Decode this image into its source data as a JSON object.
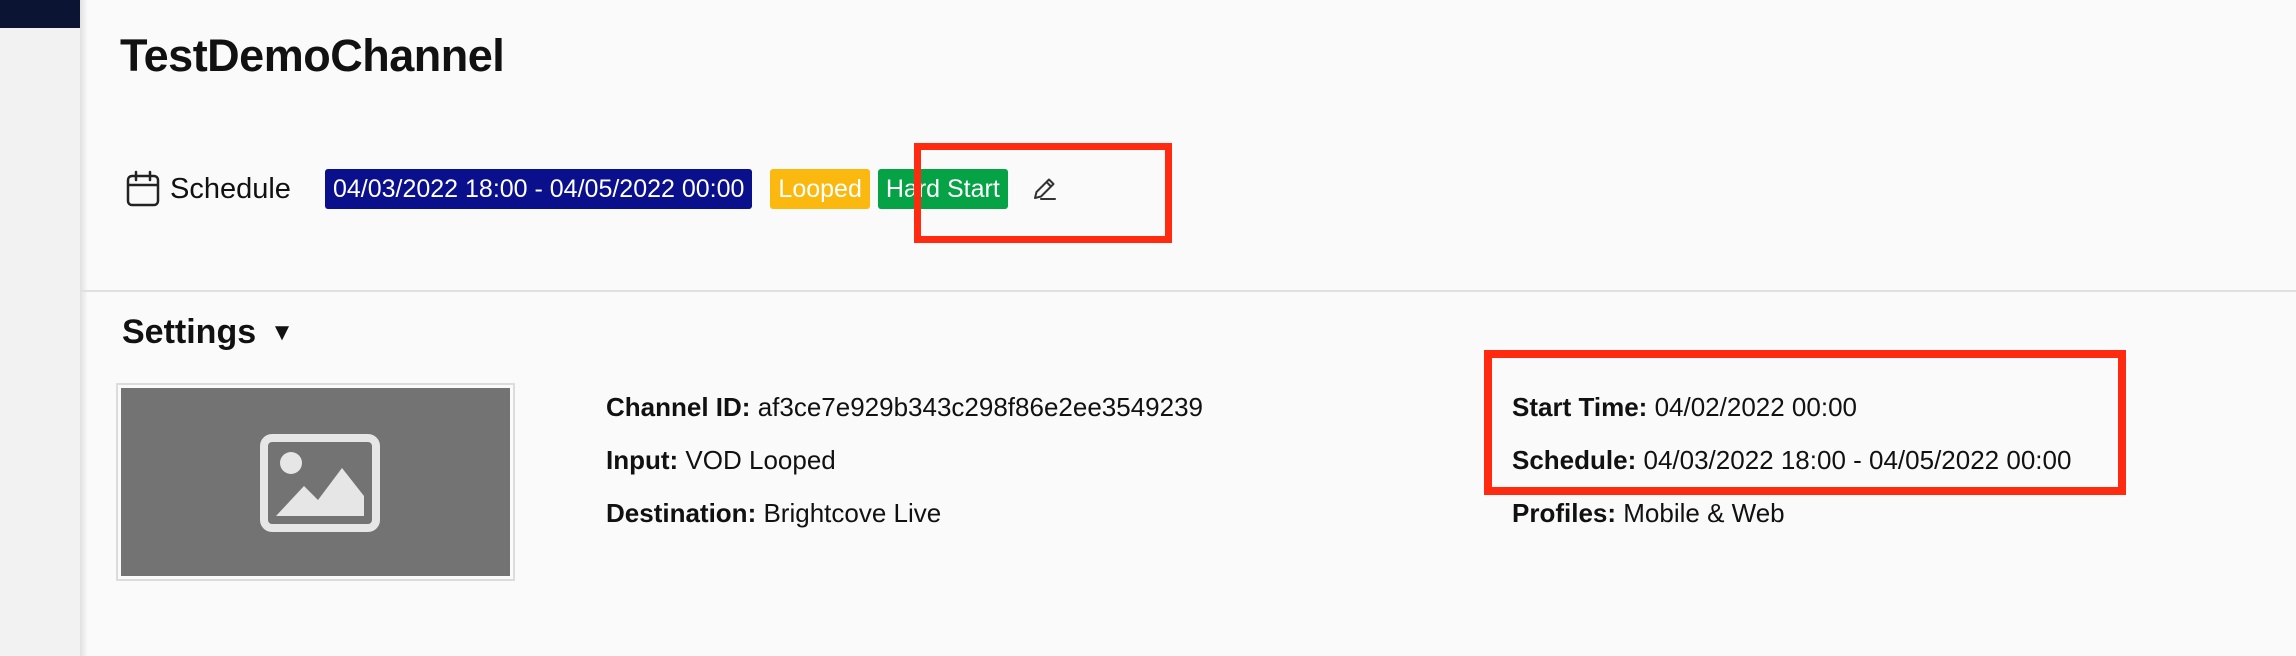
{
  "page": {
    "title": "TestDemoChannel"
  },
  "schedule": {
    "icon": "calendar-icon",
    "label": "Schedule",
    "range": "04/03/2022 18:00 - 04/05/2022 00:00",
    "looped_badge": "Looped",
    "hard_start_badge": "Hard Start",
    "edit_icon": "pencil-icon",
    "colors": {
      "range": "#0a0f8c",
      "looped": "#fbb80f",
      "hard_start": "#05a346"
    }
  },
  "settings": {
    "heading": "Settings",
    "caret": "▼",
    "thumbnail_icon": "image-placeholder-icon",
    "channel_id_label": "Channel ID:",
    "channel_id": "af3ce7e929b343c298f86e2ee3549239",
    "input_label": "Input:",
    "input": "VOD Looped",
    "destination_label": "Destination:",
    "destination": "Brightcove Live",
    "start_time_label": "Start Time:",
    "start_time": "04/02/2022 00:00",
    "schedule_label": "Schedule:",
    "schedule": "04/03/2022 18:00 - 04/05/2022 00:00",
    "profiles_label": "Profiles:",
    "profiles": "Mobile & Web"
  },
  "highlight_color": "#ff2a10"
}
